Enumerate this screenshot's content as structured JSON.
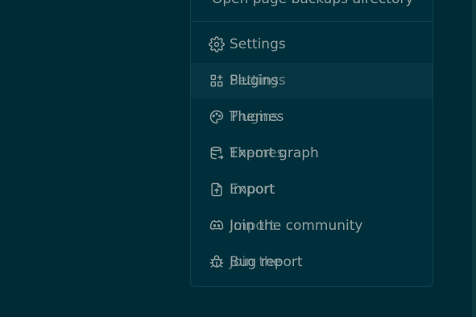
{
  "menu": {
    "top_item_label": "Open page backups directory",
    "items": [
      {
        "label": "Settings",
        "icon": "gear-icon"
      },
      {
        "label": "Plugins",
        "overlay_label": "Settings",
        "icon": "plugins-icon"
      },
      {
        "label": "Themes",
        "overlay_label": "Plugins",
        "icon": "palette-icon"
      },
      {
        "label": "Export graph",
        "overlay_label": "Themes",
        "icon": "database-export-icon"
      },
      {
        "label": "Import",
        "overlay_label": "Export",
        "icon": "file-upload-icon"
      },
      {
        "label": "Join the community",
        "overlay_label": "Import",
        "icon": "discord-icon"
      },
      {
        "label": "Bug report",
        "overlay_label": "Join the",
        "icon": "bug-icon"
      }
    ]
  },
  "colors": {
    "background": "#002b36",
    "menu_background": "#002f3b",
    "active_row": "#073642",
    "text": "#93a1a1",
    "border": "#0e4250"
  }
}
